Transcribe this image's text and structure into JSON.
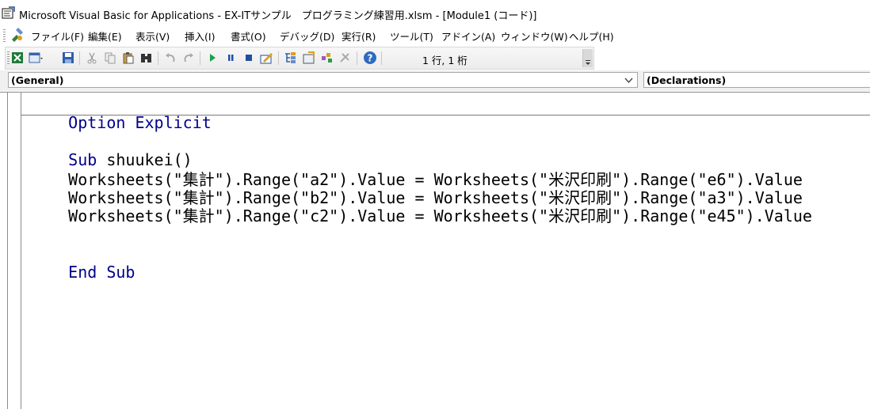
{
  "window": {
    "title": "Microsoft Visual Basic for Applications - EX-ITサンプル　プログラミング練習用.xlsm - [Module1 (コード)]"
  },
  "menu": [
    {
      "label": "ファイル(F)"
    },
    {
      "label": "編集(E)"
    },
    {
      "label": "表示(V)"
    },
    {
      "label": "挿入(I)"
    },
    {
      "label": "書式(O)"
    },
    {
      "label": "デバッグ(D)"
    },
    {
      "label": "実行(R)"
    },
    {
      "label": "ツール(T)"
    },
    {
      "label": "アドイン(A)"
    },
    {
      "label": "ウィンドウ(W)"
    },
    {
      "label": "ヘルプ(H)"
    }
  ],
  "toolbar": {
    "cursor_position": "1 行, 1 桁",
    "icons": [
      "excel-icon",
      "insert-userform-icon",
      "save-icon",
      "cut-icon",
      "copy-icon",
      "paste-icon",
      "find-icon",
      "undo-icon",
      "redo-icon",
      "run-icon",
      "break-icon",
      "reset-icon",
      "design-mode-icon",
      "project-explorer-icon",
      "properties-icon",
      "object-browser-icon",
      "toolbox-icon",
      "help-icon"
    ]
  },
  "object_box": {
    "value": "(General)"
  },
  "procedure_box": {
    "value": "(Declarations)"
  },
  "code": {
    "option_line": {
      "kw": "Option Explicit"
    },
    "sub_line": {
      "kw": "Sub",
      "rest": " shuukei()"
    },
    "statements": [
      "    Worksheets(\"集計\").Range(\"a2\").Value = Worksheets(\"米沢印刷\").Range(\"e6\").Value",
      "    Worksheets(\"集計\").Range(\"b2\").Value = Worksheets(\"米沢印刷\").Range(\"a3\").Value",
      "    Worksheets(\"集計\").Range(\"c2\").Value = Worksheets(\"米沢印刷\").Range(\"e45\").Value"
    ],
    "end_line": {
      "kw": "End Sub"
    }
  },
  "colors": {
    "keyword": "#00008b",
    "text": "#000000"
  }
}
